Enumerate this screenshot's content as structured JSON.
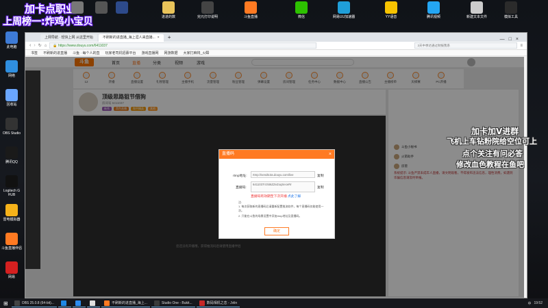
{
  "overlay": {
    "line1": "加卡点职业",
    "line2": "上周榜一:炸鸡小宝贝",
    "right1": "加卡加V进群",
    "right2": "飞机上车钻粉院给空位可上",
    "right3": "点个关注有问必答",
    "right4": "修改血色教程在鱼吧"
  },
  "desktop_icons": [
    {
      "label": "此电脑",
      "color": "#3e7bd6"
    },
    {
      "label": "网络",
      "color": "#2f8fe0"
    },
    {
      "label": "回收站",
      "color": "#6aa6ff"
    },
    {
      "label": "OBS Studio",
      "color": "#333333"
    },
    {
      "label": "腾讯QQ",
      "color": "#1a1a1a"
    },
    {
      "label": "Logitech G HUB",
      "color": "#111111"
    },
    {
      "label": "雷电模拟器",
      "color": "#f5b21a"
    },
    {
      "label": "斗鱼直播伴侣",
      "color": "#ff7a22"
    },
    {
      "label": "网易",
      "color": "#d42020"
    }
  ],
  "top_icons": [
    {
      "label": "",
      "color": "#777777"
    },
    {
      "label": "",
      "color": "#555555"
    },
    {
      "label": "",
      "color": "#2d4a8a"
    },
    {
      "label": "进进的数",
      "color": "#e8c35a"
    },
    {
      "label": "完元打印说明",
      "color": "#444444"
    },
    {
      "label": "斗鱼直播",
      "color": "#ff7a22"
    },
    {
      "label": "微信",
      "color": "#2dc100"
    },
    {
      "label": "网易UU加速器",
      "color": "#1f9ed8"
    },
    {
      "label": "YY语音",
      "color": "#f7c300"
    },
    {
      "label": "腾讯视频",
      "color": "#24a6f3"
    },
    {
      "label": "新建文本文件",
      "color": "#cccccc"
    },
    {
      "label": "模拟工具",
      "color": "#2b2b2b"
    }
  ],
  "browser": {
    "tabs": [
      {
        "label": "上网导航 · 轻快上网 从这里开始",
        "active": false
      },
      {
        "label": "不刷新的进直播_海上涯人来直播...",
        "active": true
      }
    ],
    "url": "https://www.douyu.com/6411037",
    "secure_text": "斗鱼",
    "bookmarks": [
      "书签",
      "不刷新的进直播",
      "斗鱼 · 每个人的直",
      "玩家老司机招募平台",
      "游戏直播网",
      "网游数据",
      "大家打麻将_火瞬"
    ],
    "search_placeholder": "3天中季达通过财报我系"
  },
  "douyu": {
    "logo": "斗鱼",
    "nav": [
      "首页",
      "直播",
      "分类",
      "视频",
      "游戏"
    ],
    "icons": [
      "12",
      "开播",
      "直播设置",
      "礼物管理",
      "主播手机",
      "流量管理",
      "粉丝管理",
      "弹幕设置",
      "房间管理",
      "任务中心",
      "数据中心",
      "直播公告",
      "主播榜单",
      "天梯赛",
      "PC开播"
    ],
    "streamer_name": "顶级思路狙节借狗",
    "room_id": "房间号 6411037",
    "tags": [
      "新秀",
      "黑色直播",
      "和平精英",
      "其他"
    ],
    "video_hint": "您还没有开播哦，获得推流码后请使用直播伴侣",
    "chat": [
      {
        "name": "斗鱼小秘书",
        "text": ""
      },
      {
        "name": "火箭助手",
        "text": ""
      },
      {
        "name": "房管",
        "text": ""
      }
    ],
    "announcement": "系统提示: 斗鱼严禁未成年人直播，请文明观看，不得发布违法信息，理性消费，如遇到诈骗信息请及时举报。"
  },
  "dialog": {
    "title": "直播码",
    "rtmp_label": "rtmp地址:",
    "rtmp_value": "rtmp://sendtc3a.douyu.com/live",
    "copy1": "复制",
    "key_label": "直播码:",
    "key_value": "6411037rrz5t6ZZeZoqSeceRr",
    "copy2": "复制",
    "warn_text": "直播码有效期至下次开播",
    "help_link": "点此了解",
    "notes": [
      "注:",
      "1. 每次获取新的直播码后请重新配置推流软件，每个直播码仅能使用一次。",
      "2. 只能在斗鱼的场景设置中添加rtmp地址及直播码。"
    ],
    "ok_label": "确定"
  },
  "taskbar": {
    "items": [
      {
        "label": "OBS 25.0.8 (64-bit)...",
        "color": "#444444"
      },
      {
        "label": "",
        "color": "#1e88e5"
      },
      {
        "label": "",
        "color": "#2d8cf0"
      },
      {
        "label": "",
        "color": "#e0e0e0"
      },
      {
        "label": "不刷新的进直播_海上...",
        "color": "#ff7a22"
      },
      {
        "label": "Studio One - Bukit...",
        "color": "#3a3a3a"
      },
      {
        "label": "数码相机之恋 - Jvlin",
        "color": "#c62828"
      }
    ],
    "time": "19:52",
    "lang": "中"
  }
}
